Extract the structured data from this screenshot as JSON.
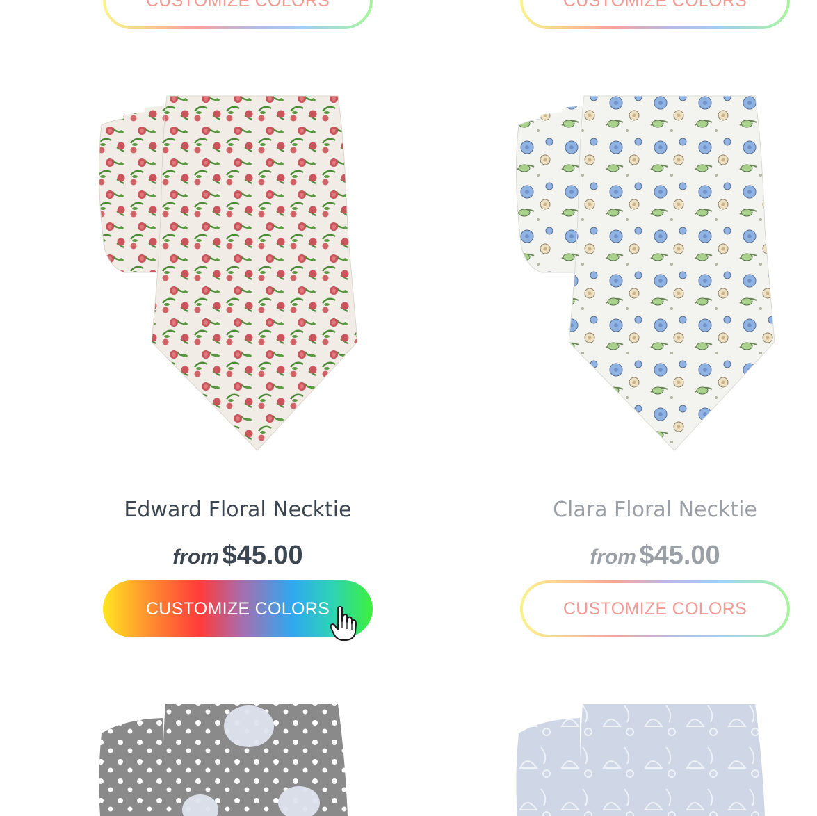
{
  "products_top_row": [
    {
      "button_label": "CUSTOMIZE COLORS"
    },
    {
      "button_label": "CUSTOMIZE COLORS"
    }
  ],
  "products": [
    {
      "name": "Edward Floral Necktie",
      "price_prefix": "from",
      "price": "$45.00",
      "button_label": "CUSTOMIZE COLORS",
      "pattern": "red roses on cream"
    },
    {
      "name": "Clara Floral Necktie",
      "price_prefix": "from",
      "price": "$45.00",
      "button_label": "CUSTOMIZE COLORS",
      "pattern": "blue flowers on white"
    }
  ],
  "colors": {
    "title_active": "#3c4650",
    "title_muted": "#9aa0a6",
    "button_text": "#f29a94"
  },
  "icons": [
    "hand-pointer-cursor-icon"
  ]
}
